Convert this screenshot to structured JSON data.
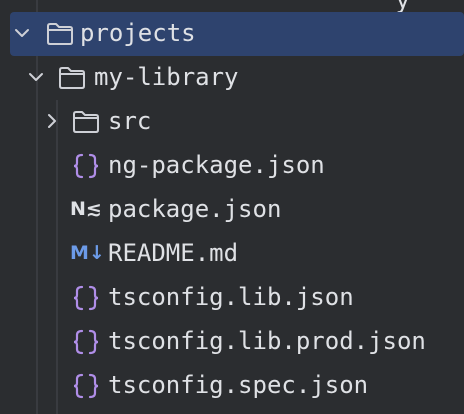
{
  "colors": {
    "background": "#2b2d30",
    "selection": "#2e436e",
    "text": "#dfe1e5",
    "folder_stroke": "#ced0d6",
    "json_icon": "#b08ee8",
    "markdown_icon": "#6c9be8"
  },
  "tree": {
    "partial_top_text": "y",
    "projects": {
      "label": "projects",
      "icon": "folder-icon",
      "expanded": true,
      "selected": true
    },
    "my_library": {
      "label": "my-library",
      "icon": "folder-icon",
      "expanded": true
    },
    "src": {
      "label": "src",
      "icon": "folder-icon",
      "expanded": false
    },
    "files": [
      {
        "label": "ng-package.json",
        "icon": "json-braces-icon"
      },
      {
        "label": "package.json",
        "icon": "npm-package-icon",
        "icon_text": "N≲"
      },
      {
        "label": "README.md",
        "icon": "markdown-icon",
        "icon_text": "M↓"
      },
      {
        "label": "tsconfig.lib.json",
        "icon": "json-braces-icon"
      },
      {
        "label": "tsconfig.lib.prod.json",
        "icon": "json-braces-icon"
      },
      {
        "label": "tsconfig.spec.json",
        "icon": "json-braces-icon"
      }
    ]
  }
}
